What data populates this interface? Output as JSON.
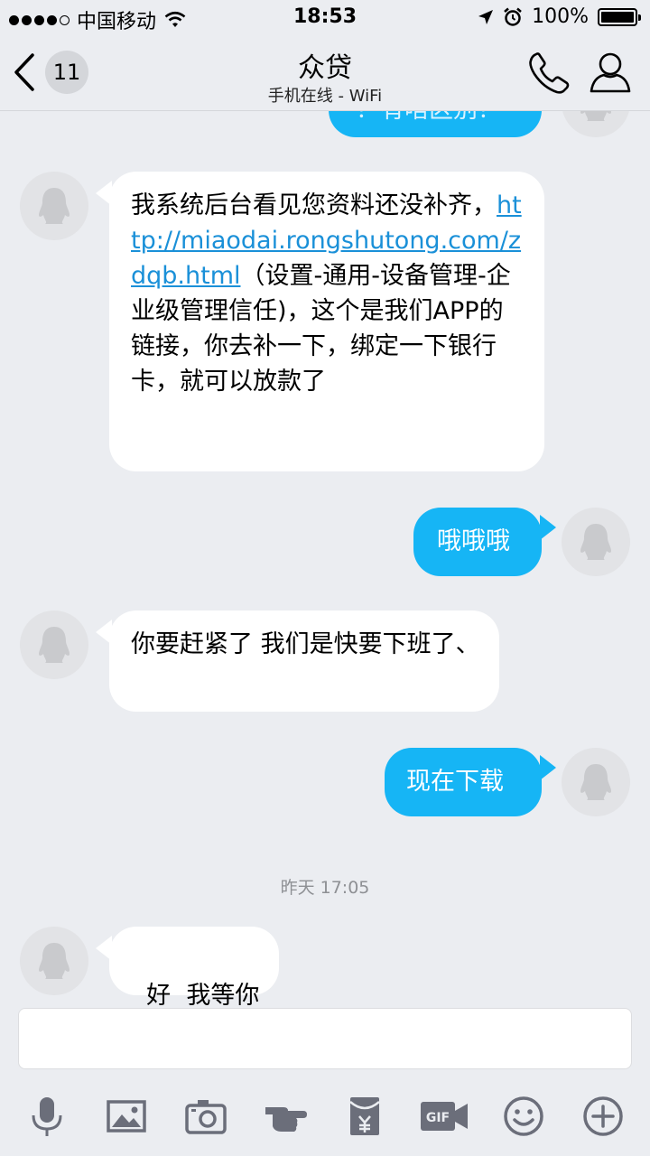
{
  "status_bar": {
    "carrier": "中国移动",
    "time": "18:53",
    "battery": "100%"
  },
  "nav": {
    "back_count": "11",
    "title": "众贷",
    "subtitle": "手机在线 - WiFi"
  },
  "messages": {
    "top_partial": "？有啥区别？",
    "m1_before": "我系统后台看见您资料还没补齐，",
    "m1_link": "http://miaodai.rongshutong.com/zdqb.html",
    "m1_after": "（设置-通用-设备管理-企业级管理信任)，这个是我们APP的链接，你去补一下，绑定一下银行卡，就可以放款了",
    "m2": "哦哦哦",
    "m3": "你要赶紧了 我们是快要下班了、",
    "m4": "现在下载",
    "timestamp": "昨天 17:05",
    "m5": "好  我等你"
  },
  "colors": {
    "outgoing": "#16b5f5",
    "incoming": "#ffffff",
    "background": "#ebedf1",
    "link": "#1a90d8"
  },
  "toolbar": {
    "icons": [
      "microphone-icon",
      "image-icon",
      "camera-icon",
      "poke-icon",
      "red-packet-icon",
      "gif-icon",
      "emoji-icon",
      "plus-icon"
    ]
  }
}
